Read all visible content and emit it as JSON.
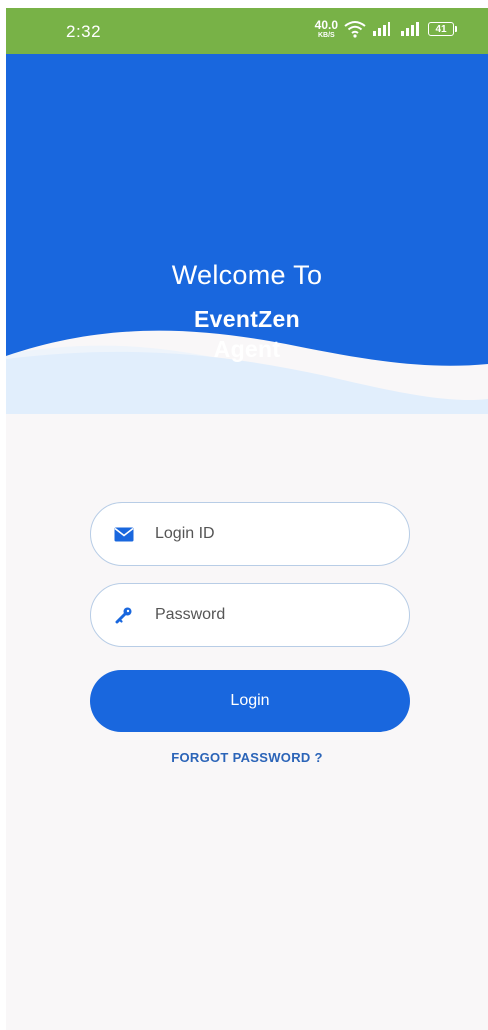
{
  "status_bar": {
    "time": "2:32",
    "net_speed_value": "40.0",
    "net_speed_unit": "KB/S",
    "battery": "41",
    "color": "#78b247"
  },
  "header": {
    "welcome": "Welcome To",
    "brand_line1": "EventZen",
    "brand_line2": "Agent",
    "color": "#1967de"
  },
  "form": {
    "login_id": {
      "placeholder": "Login ID",
      "value": "",
      "icon": "envelope-icon"
    },
    "password": {
      "placeholder": "Password",
      "value": "",
      "icon": "key-icon"
    },
    "login_label": "Login",
    "forgot_label": "FORGOT PASSWORD ?"
  }
}
